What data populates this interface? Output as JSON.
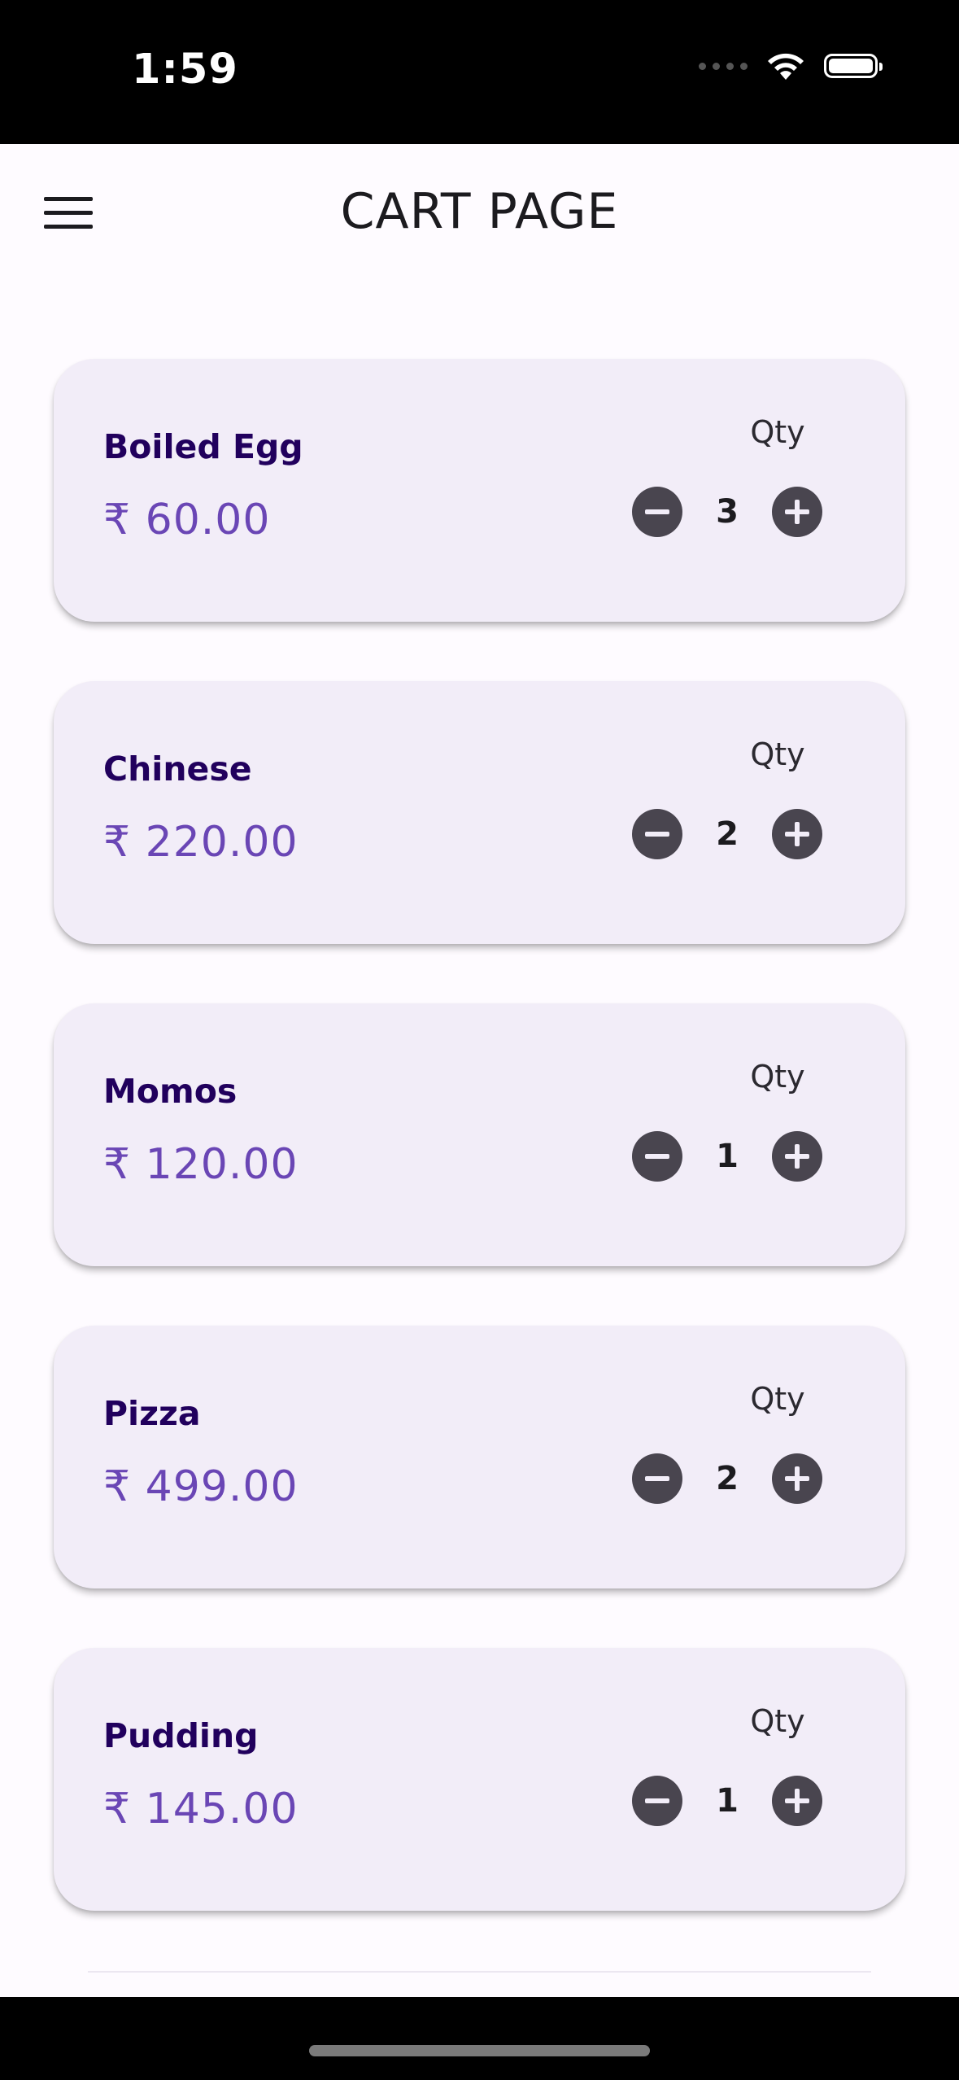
{
  "status_bar": {
    "time": "1:59"
  },
  "app_bar": {
    "title": "CART PAGE",
    "menu_icon": "hamburger-menu-icon"
  },
  "cart": {
    "qty_label": "Qty",
    "items": [
      {
        "name": "Boiled Egg",
        "price": "₹ 60.00",
        "qty": "3"
      },
      {
        "name": "Chinese",
        "price": "₹ 220.00",
        "qty": "2"
      },
      {
        "name": "Momos",
        "price": "₹ 120.00",
        "qty": "1"
      },
      {
        "name": "Pizza",
        "price": "₹ 499.00",
        "qty": "2"
      },
      {
        "name": "Pudding",
        "price": "₹ 145.00",
        "qty": "1"
      }
    ]
  },
  "colors": {
    "card_bg": "#f2edf8",
    "item_name": "#21005d",
    "price": "#6a46b5",
    "qty_button": "#49454f"
  }
}
